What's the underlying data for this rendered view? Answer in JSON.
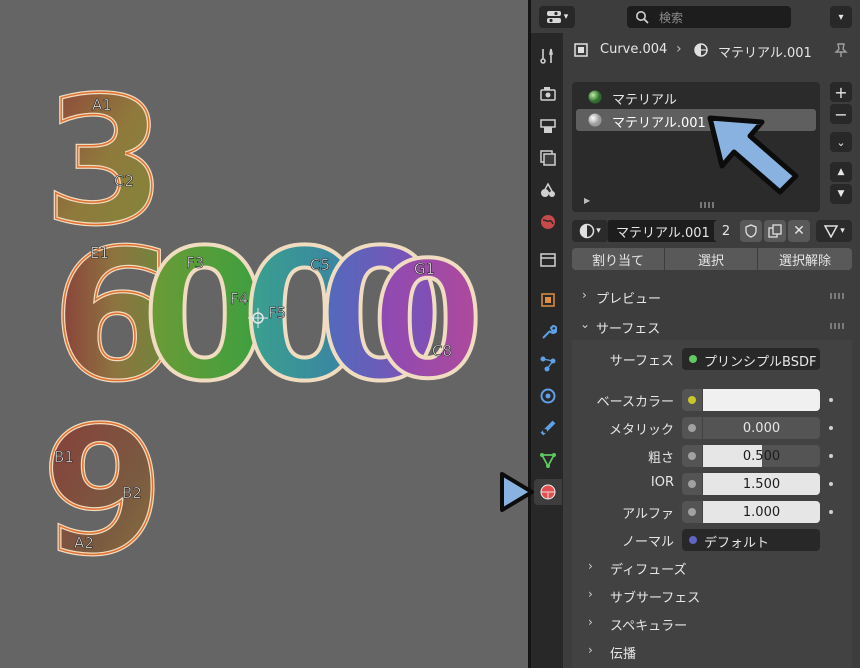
{
  "header": {
    "search_placeholder": "検索",
    "breadcrumb_object": "Curve.004",
    "breadcrumb_separator": "›",
    "breadcrumb_material": "マテリアル.001"
  },
  "material_slots": [
    {
      "label": "マテリアル",
      "selected": false
    },
    {
      "label": "マテリアル.001",
      "selected": true
    }
  ],
  "slot_controls": {
    "add": "+",
    "remove": "−"
  },
  "datablock": {
    "name": "マテリアル.001",
    "users": "2"
  },
  "assign_row": {
    "assign": "割り当て",
    "select": "選択",
    "deselect": "選択解除"
  },
  "panels": {
    "preview": "プレビュー",
    "surface": "サーフェス",
    "diffuse": "ディフューズ",
    "subsurface": "サブサーフェス",
    "specular": "スペキュラー",
    "transmission": "伝播"
  },
  "surface": {
    "shader_label": "サーフェス",
    "shader_value": "プリンシプルBSDF",
    "base_color_label": "ベースカラー",
    "base_color_value": "#f0f0f0",
    "metallic_label": "メタリック",
    "metallic_value": "0.000",
    "metallic_fraction": 0.0,
    "roughness_label": "粗さ",
    "roughness_value": "0.500",
    "roughness_fraction": 0.5,
    "ior_label": "IOR",
    "ior_value": "1.500",
    "ior_fraction": 1.0,
    "alpha_label": "アルファ",
    "alpha_value": "1.000",
    "alpha_fraction": 1.0,
    "normal_label": "ノーマル",
    "normal_value": "デフォルト"
  },
  "viewport_numbers": {
    "top": "3",
    "middle": "6000",
    "bottom": "9"
  },
  "viewport_labels": [
    "A1",
    "C2",
    "F3",
    "F4",
    "F5",
    "C5",
    "G1",
    "C8",
    "E1",
    "B1",
    "B2",
    "A2"
  ],
  "colors": {
    "accent": "#4772b3",
    "annotation_arrow": "#8ab2e0",
    "shader_socket": "#63c763",
    "color_socket": "#c7c729",
    "float_socket": "#a1a1a1",
    "vector_socket": "#6363c7"
  }
}
